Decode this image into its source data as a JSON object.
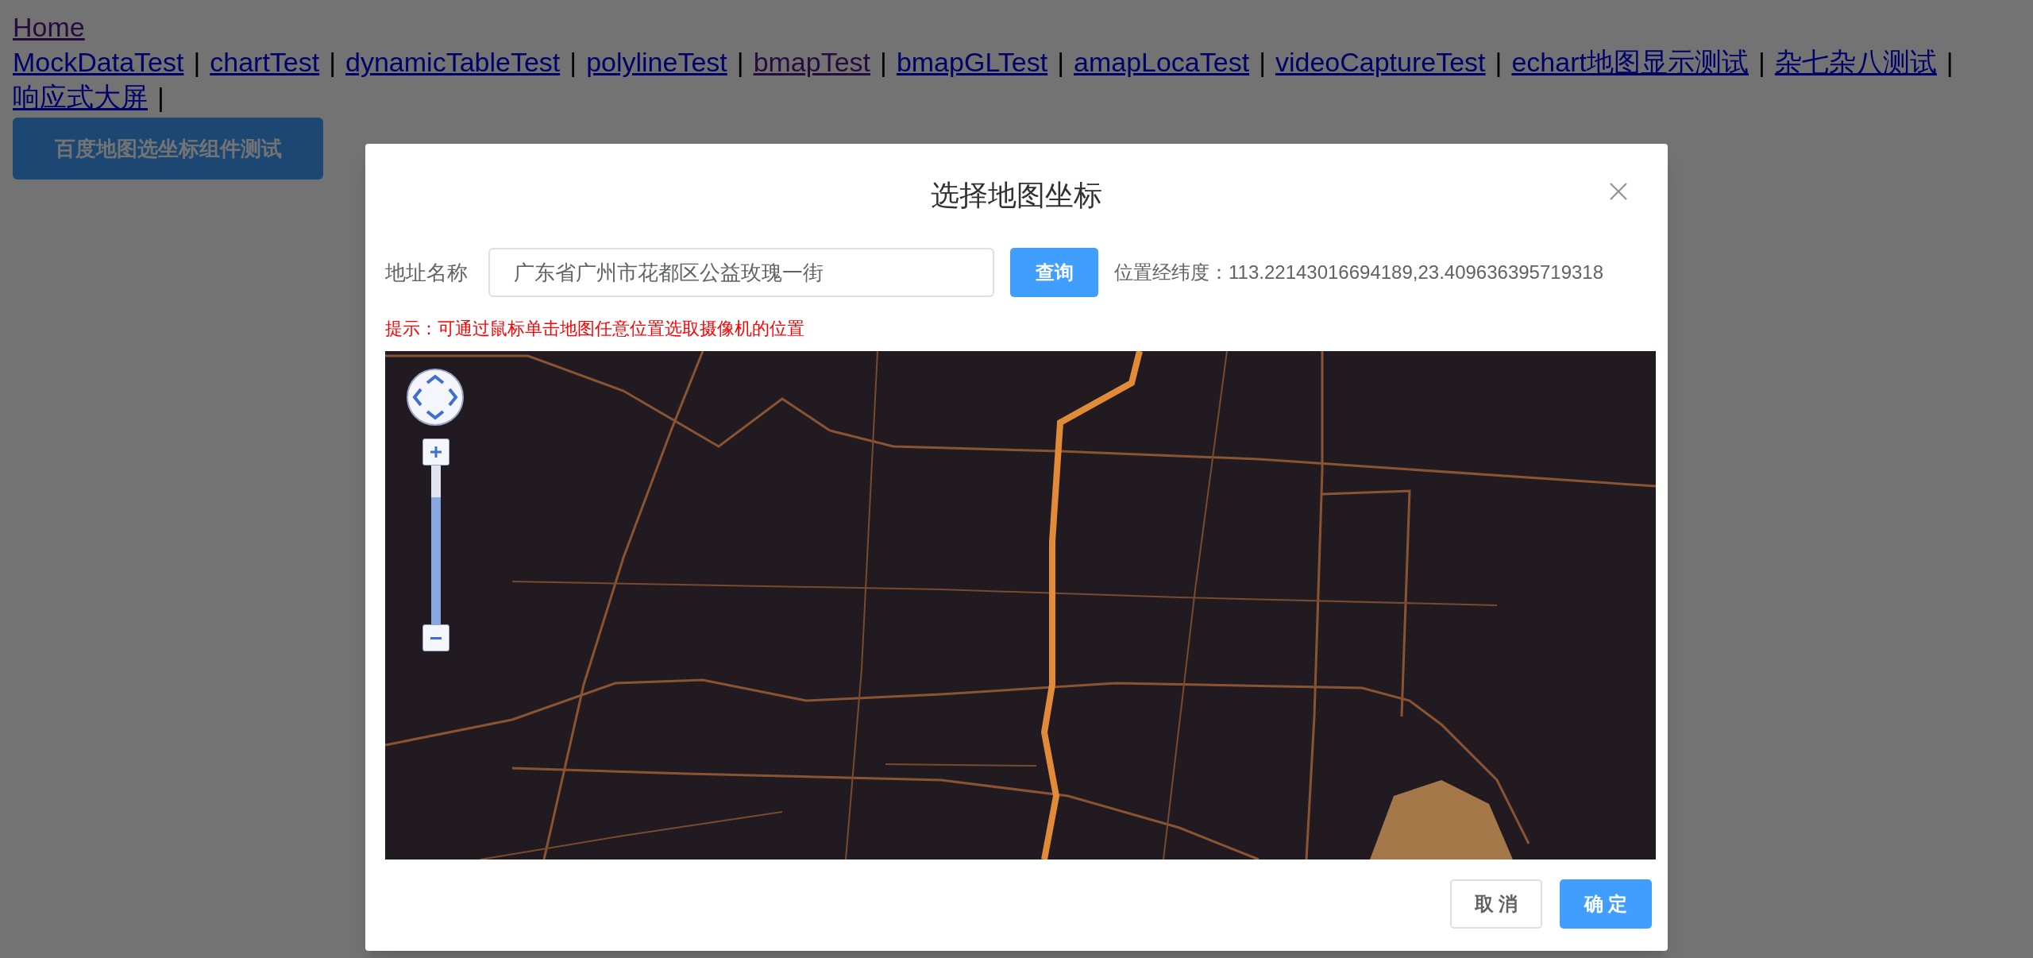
{
  "page": {
    "home_link": {
      "label": "Home",
      "visited": true
    },
    "nav_links": [
      {
        "label": "MockDataTest",
        "visited": false,
        "separator": "|"
      },
      {
        "label": "chartTest",
        "visited": false,
        "separator": "|"
      },
      {
        "label": "dynamicTableTest",
        "visited": false,
        "separator": "|"
      },
      {
        "label": "polylineTest",
        "visited": false,
        "separator": "|"
      },
      {
        "label": "bmapTest",
        "visited": true,
        "separator": "|"
      },
      {
        "label": "bmapGLTest",
        "visited": false,
        "separator": "|"
      },
      {
        "label": "amapLocaTest",
        "visited": false,
        "separator": "|"
      },
      {
        "label": "videoCaptureTest",
        "visited": false,
        "separator": "|"
      },
      {
        "label": "echart地图显示测试",
        "visited": false,
        "separator": "|"
      },
      {
        "label": "杂七杂八测试",
        "visited": false,
        "separator": "|"
      },
      {
        "label": "响应式大屏",
        "visited": false,
        "separator": "|"
      }
    ],
    "open_button": "百度地图选坐标组件测试"
  },
  "dialog": {
    "title": "选择地图坐标",
    "address_label": "地址名称",
    "address_value": "广东省广州市花都区公益玫瑰一街",
    "search_button": "查询",
    "coords_label": "位置经纬度：",
    "coords_value": "113.22143016694189,23.409636395719318",
    "hint": "提示：可通过鼠标单击地图任意位置选取摄像机的位置",
    "map": {
      "level": 0.8
    },
    "buttons": [
      {
        "label": "取 消",
        "kind": "default"
      },
      {
        "label": "确 定",
        "kind": "primary"
      }
    ]
  }
}
